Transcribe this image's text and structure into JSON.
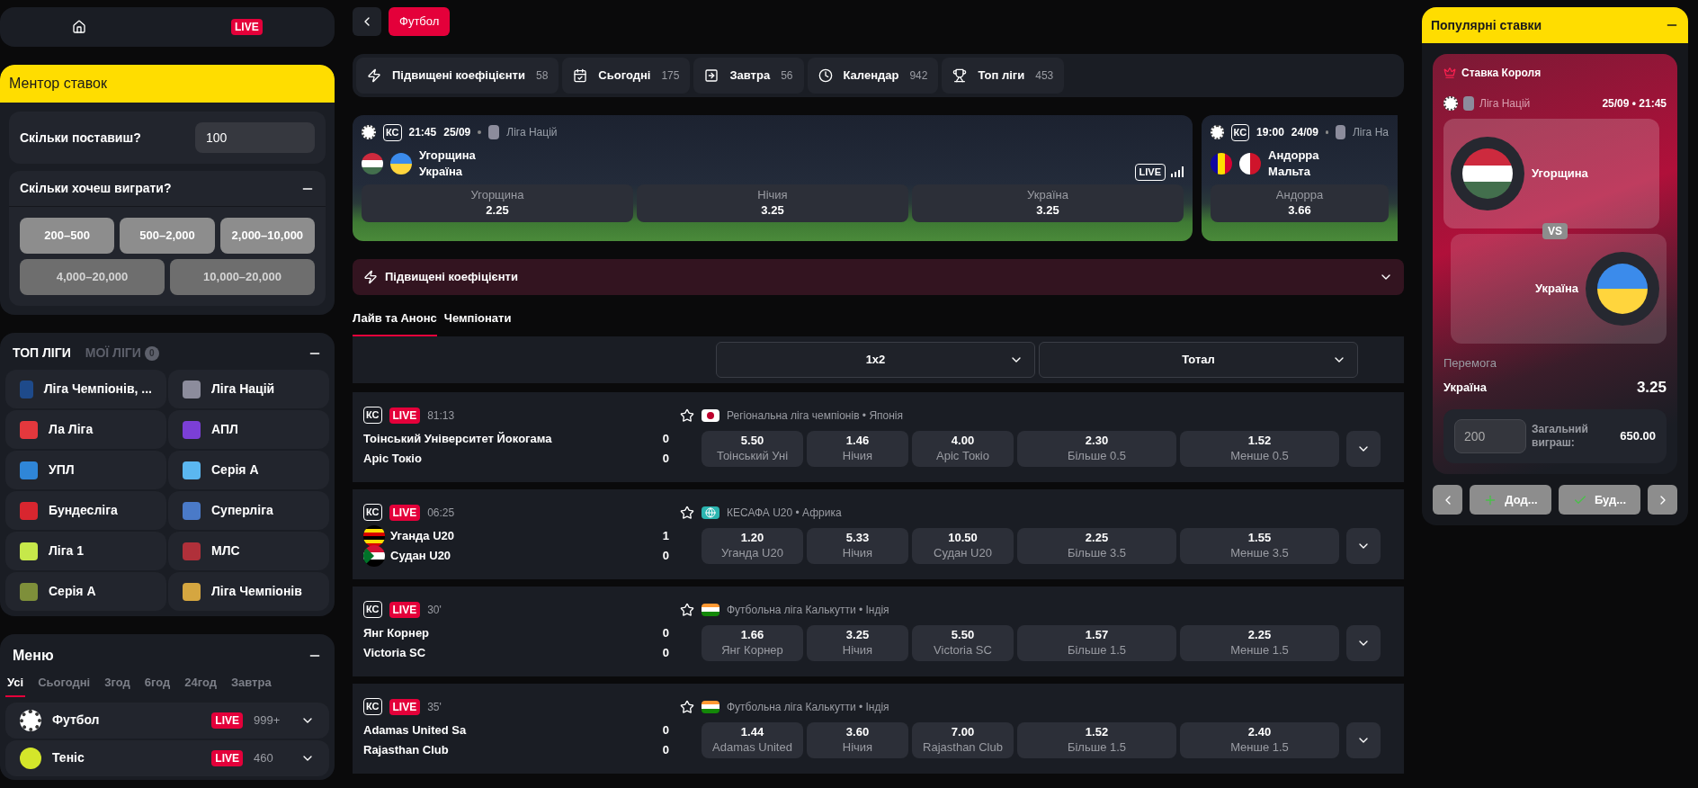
{
  "nav": {
    "live": "LIVE"
  },
  "mentor": {
    "title": "Ментор ставок",
    "stake_label": "Скільки поставиш?",
    "stake_value": "100",
    "win_label": "Скільки хочеш виграти?",
    "expanded": true,
    "ranges": [
      {
        "label": "200–500",
        "disabled": false
      },
      {
        "label": "500–2,000",
        "disabled": false
      },
      {
        "label": "2,000–10,000",
        "disabled": false
      },
      {
        "label": "4,000–20,000",
        "disabled": true
      },
      {
        "label": "10,000–20,000",
        "disabled": true
      }
    ]
  },
  "top_leagues": {
    "expanded": true,
    "tabs": [
      {
        "label": "ТОП ЛІГИ",
        "selected": true
      },
      {
        "label": "МОЇ ЛІГИ",
        "selected": false,
        "count": "0"
      }
    ],
    "items": [
      "Ліга Чемпіонів, ...",
      "Ліга Націй",
      "Ла Ліга",
      "АПЛ",
      "УПЛ",
      "Серія А",
      "Бундесліга",
      "Суперліга",
      "Ліга 1",
      "МЛС",
      "Серія А",
      "Ліга Чемпіонів"
    ]
  },
  "menu": {
    "title": "Меню",
    "expanded": true,
    "tabs": [
      {
        "label": "Усі",
        "selected": true
      },
      {
        "label": "Сьогодні",
        "selected": false
      },
      {
        "label": "3год",
        "selected": false
      },
      {
        "label": "6год",
        "selected": false
      },
      {
        "label": "24год",
        "selected": false
      },
      {
        "label": "Завтра",
        "selected": false
      }
    ],
    "sports": [
      {
        "kind": "football",
        "name": "Футбол",
        "live": "LIVE",
        "count": "999+"
      },
      {
        "kind": "tennis",
        "name": "Теніс",
        "live": "LIVE",
        "count": "460"
      }
    ]
  },
  "breadcrumb": {
    "current": "Футбол"
  },
  "filters": [
    {
      "label": "Підвищені коефіцієнти",
      "count": "58"
    },
    {
      "label": "Сьогодні",
      "count": "175"
    },
    {
      "label": "Завтра",
      "count": "56"
    },
    {
      "label": "Календар",
      "count": "942"
    },
    {
      "label": "Топ ліги",
      "count": "453"
    }
  ],
  "featured": [
    {
      "badge": "КС",
      "time": "21:45",
      "date": "25/09",
      "league": "Ліга Націй",
      "live": "LIVE",
      "teams": [
        {
          "name": "Угорщина",
          "kind": "hu"
        },
        {
          "name": "Україна",
          "kind": "ua"
        }
      ],
      "odds": [
        {
          "label": "Угорщина",
          "value": "2.25"
        },
        {
          "label": "Нічия",
          "value": "3.25"
        },
        {
          "label": "Україна",
          "value": "3.25"
        }
      ]
    },
    {
      "badge": "КС",
      "time": "19:00",
      "date": "24/09",
      "league": "Ліга На",
      "teams": [
        {
          "name": "Андорра",
          "kind": "ad"
        },
        {
          "name": "Мальта",
          "kind": "mt"
        }
      ],
      "odds": [
        {
          "label": "Андорра",
          "value": "3.66"
        }
      ]
    }
  ],
  "boosted": {
    "title": "Підвищені коефіцієнти",
    "expanded": false
  },
  "section_tabs": [
    {
      "label": "Лайв та Анонс",
      "selected": true
    },
    {
      "label": "Чемпіонати",
      "selected": false
    }
  ],
  "market_selects": [
    "1x2",
    "Тотал"
  ],
  "matches": [
    {
      "badge": "КС",
      "live": "LIVE",
      "time": "81:13",
      "league": {
        "kind": "jp",
        "name": "Регіональна ліга чемпіонів • Японія"
      },
      "teams": [
        {
          "name": "Тоінський Університет Йокогама",
          "score": "0"
        },
        {
          "name": "Аріс Токіо",
          "score": "0"
        }
      ],
      "odds": [
        {
          "value": "5.50",
          "label": "Тоінський Уні"
        },
        {
          "value": "1.46",
          "label": "Нічия"
        },
        {
          "value": "4.00",
          "label": "Аріс Токіо"
        },
        {
          "value": "2.30",
          "label": "Більше 0.5"
        },
        {
          "value": "1.52",
          "label": "Менше 0.5"
        }
      ]
    },
    {
      "badge": "КС",
      "live": "LIVE",
      "time": "06:25",
      "league": {
        "kind": "world",
        "name": "КЕСАФА U20 • Африка"
      },
      "teams": [
        {
          "name": "Уганда U20",
          "score": "1",
          "kind": "ug"
        },
        {
          "name": "Судан U20",
          "score": "0",
          "kind": "sd"
        }
      ],
      "odds": [
        {
          "value": "1.20",
          "label": "Уганда U20"
        },
        {
          "value": "5.33",
          "label": "Нічия"
        },
        {
          "value": "10.50",
          "label": "Судан U20"
        },
        {
          "value": "2.25",
          "label": "Більше 3.5"
        },
        {
          "value": "1.55",
          "label": "Менше 3.5"
        }
      ]
    },
    {
      "badge": "КС",
      "live": "LIVE",
      "time": "30'",
      "league": {
        "kind": "in",
        "name": "Футбольна ліга Калькутти • Індія"
      },
      "teams": [
        {
          "name": "Янг Корнер",
          "score": "0"
        },
        {
          "name": "Victoria SC",
          "score": "0"
        }
      ],
      "odds": [
        {
          "value": "1.66",
          "label": "Янг Корнер"
        },
        {
          "value": "3.25",
          "label": "Нічия"
        },
        {
          "value": "5.50",
          "label": "Victoria SC"
        },
        {
          "value": "1.57",
          "label": "Більше 1.5"
        },
        {
          "value": "2.25",
          "label": "Менше 1.5"
        }
      ]
    },
    {
      "badge": "КС",
      "live": "LIVE",
      "time": "35'",
      "league": {
        "kind": "in",
        "name": "Футбольна ліга Калькутти • Індія"
      },
      "teams": [
        {
          "name": "Adamas United Sa",
          "score": "0"
        },
        {
          "name": "Rajasthan Club",
          "score": "0"
        }
      ],
      "odds": [
        {
          "value": "1.44",
          "label": "Adamas United"
        },
        {
          "value": "3.60",
          "label": "Нічия"
        },
        {
          "value": "7.00",
          "label": "Rajasthan Club"
        },
        {
          "value": "1.52",
          "label": "Більше 1.5"
        },
        {
          "value": "2.40",
          "label": "Менше 1.5"
        }
      ]
    }
  ],
  "popular": {
    "title": "Популярні ставки",
    "expanded": true,
    "card_title": "Ставка Короля",
    "league": "Ліга Націй",
    "datetime": "25/09 • 21:45",
    "teams": [
      {
        "name": "Угорщина",
        "kind": "hu"
      },
      {
        "name": "Україна",
        "kind": "ua"
      }
    ],
    "vs": "VS",
    "market": "Перемога",
    "pick": "Україна",
    "odd": "3.25",
    "stake": "200",
    "total_label": "Загальний виграш:",
    "total": "650.00",
    "add": "Дод...",
    "confirm": "Буд..."
  }
}
